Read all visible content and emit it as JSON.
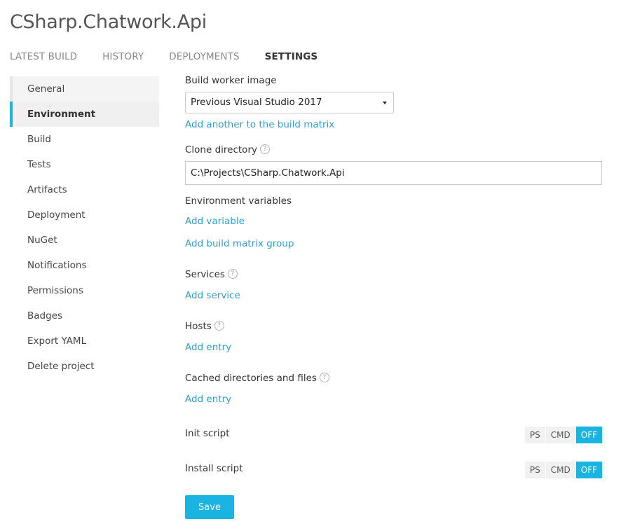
{
  "project": {
    "title": "CSharp.Chatwork.Api"
  },
  "tabs": [
    {
      "label": "LATEST BUILD",
      "active": false
    },
    {
      "label": "HISTORY",
      "active": false
    },
    {
      "label": "DEPLOYMENTS",
      "active": false
    },
    {
      "label": "SETTINGS",
      "active": true
    }
  ],
  "sidebar": {
    "items": [
      {
        "label": "General"
      },
      {
        "label": "Environment",
        "active": true
      },
      {
        "label": "Build"
      },
      {
        "label": "Tests"
      },
      {
        "label": "Artifacts"
      },
      {
        "label": "Deployment"
      },
      {
        "label": "NuGet"
      },
      {
        "label": "Notifications"
      },
      {
        "label": "Permissions"
      },
      {
        "label": "Badges"
      },
      {
        "label": "Export YAML"
      },
      {
        "label": "Delete project"
      }
    ]
  },
  "form": {
    "build_worker_image": {
      "label": "Build worker image",
      "value": "Previous Visual Studio 2017",
      "add_link": "Add another to the build matrix"
    },
    "clone_directory": {
      "label": "Clone directory",
      "value": "C:\\Projects\\CSharp.Chatwork.Api"
    },
    "environment_variables": {
      "label": "Environment variables",
      "add_variable": "Add variable",
      "add_group": "Add build matrix group"
    },
    "services": {
      "label": "Services",
      "add_link": "Add service"
    },
    "hosts": {
      "label": "Hosts",
      "add_link": "Add entry"
    },
    "cache": {
      "label": "Cached directories and files",
      "add_link": "Add entry"
    },
    "init_script": {
      "label": "Init script",
      "options": [
        "PS",
        "CMD",
        "OFF"
      ],
      "selected": "OFF"
    },
    "install_script": {
      "label": "Install script",
      "options": [
        "PS",
        "CMD",
        "OFF"
      ],
      "selected": "OFF"
    },
    "help_glyph": "?",
    "save_label": "Save"
  },
  "colors": {
    "accent": "#1ab4e3",
    "link": "#2ea1d4"
  }
}
